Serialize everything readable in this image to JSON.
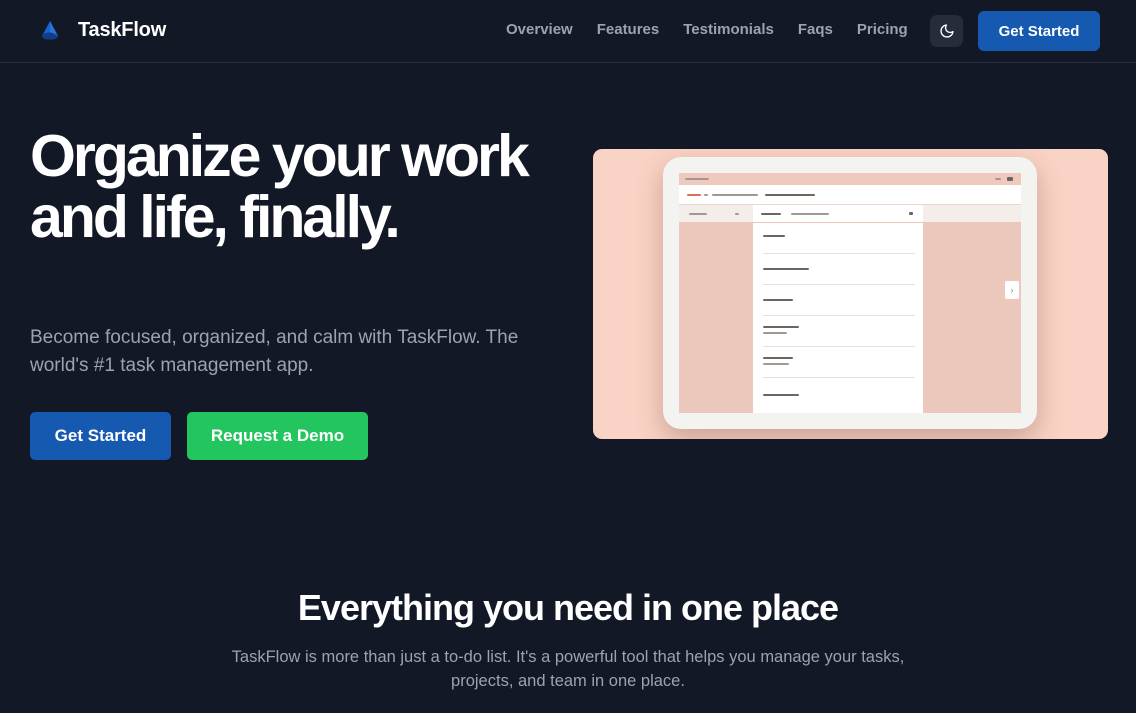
{
  "brand": {
    "name": "TaskFlow",
    "logo_icon": "triangle-logo-icon",
    "accent": "#1559b0"
  },
  "nav": {
    "links": [
      "Overview",
      "Features",
      "Testimonials",
      "Faqs",
      "Pricing"
    ],
    "theme_toggle_icon": "moon-icon",
    "cta_label": "Get Started"
  },
  "hero": {
    "title": "Organize your work and life, finally.",
    "subtitle": "Become focused, organized, and calm with TaskFlow. The world's #1 task management app.",
    "primary_button": "Get Started",
    "secondary_button": "Request a Demo",
    "primary_color": "#1559b0",
    "secondary_color": "#22c55e",
    "image_background": "#f9d3c5"
  },
  "features": {
    "title": "Everything you need in one place",
    "description": "TaskFlow is more than just a to-do list. It's a powerful tool that helps you manage your tasks, projects, and team in one place."
  }
}
